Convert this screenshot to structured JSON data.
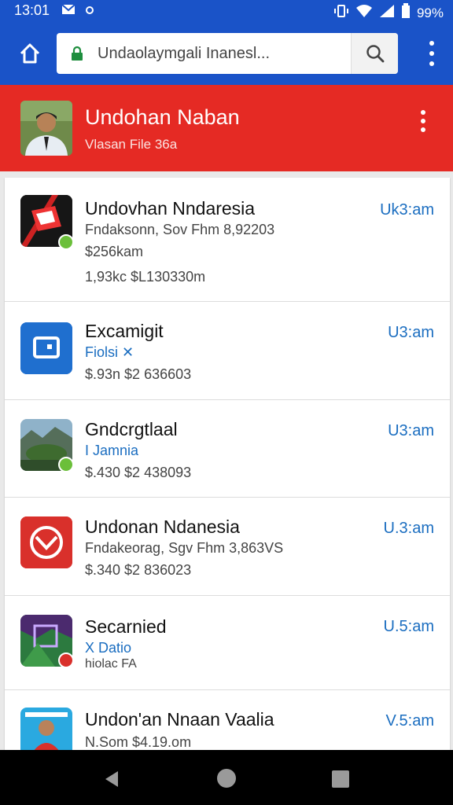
{
  "status_bar": {
    "time": "13:01",
    "battery": "99%"
  },
  "toolbar": {
    "url": "Undaolaymgali Inanesl..."
  },
  "profile": {
    "name": "Undohan Naban",
    "subtitle": "Vlasan File 36a"
  },
  "list": [
    {
      "title": "Undovhan Nndaresia",
      "lines": [
        "Fndaksonn, Sov Fhm 8,92203",
        "$256kam",
        "1,93kc $L130330m"
      ],
      "time": "Uk3:am",
      "icon": "red-envelope-icon"
    },
    {
      "title": "Excamigit",
      "lines": [
        "Fiolsi ✕"
      ],
      "extra": "$.93n $2 636603",
      "time": "U3:am",
      "icon": "blue-square-icon"
    },
    {
      "title": "Gndcrgtlaal",
      "lines": [
        "I Jamnia"
      ],
      "extra": "$.430 $2 438093",
      "time": "U3:am",
      "icon": "landscape-icon"
    },
    {
      "title": "Undonan Ndanesia",
      "lines": [
        "Fndakeorag, Sgv Fhm 3,863VS"
      ],
      "extra": "$.340 $2 836023",
      "time": "U.3:am",
      "icon": "no-sign-icon"
    },
    {
      "title": "Secarnied",
      "lines": [
        "X Datio"
      ],
      "extra": "hiolac FA",
      "time": "U.5:am",
      "icon": "forest-icon"
    },
    {
      "title": "Undon'an Nnaan Vaalia",
      "lines": [
        "N.Som $4.19.om"
      ],
      "time": "V.5:am",
      "icon": "person-poster-icon"
    }
  ]
}
